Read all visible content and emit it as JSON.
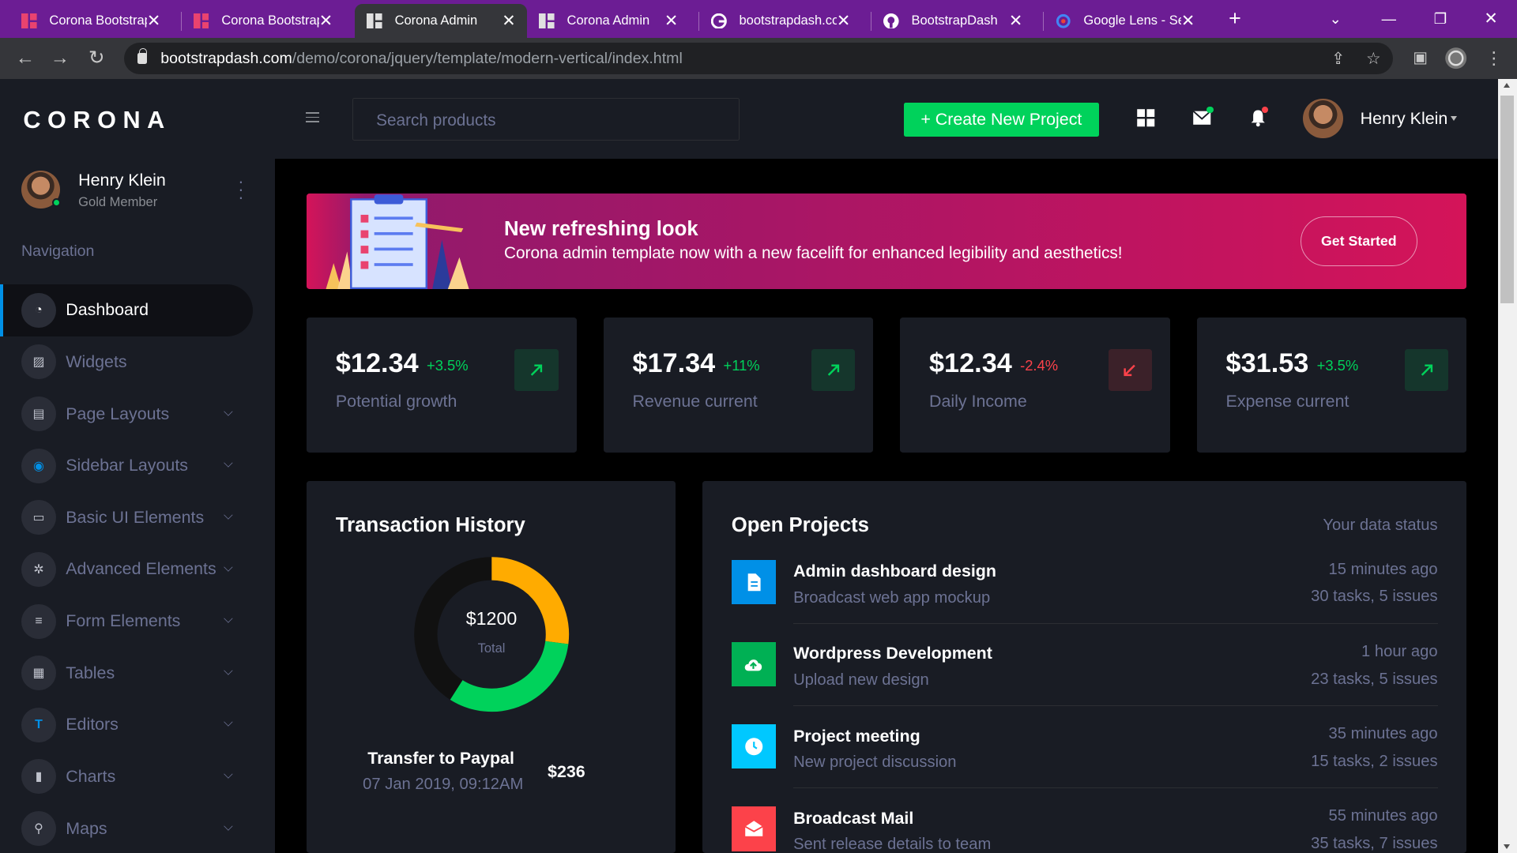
{
  "browser": {
    "tabs": [
      {
        "title": "Corona Bootstrap",
        "favicon": "corona-favicon"
      },
      {
        "title": "Corona Bootstrap",
        "favicon": "corona-favicon"
      },
      {
        "title": "Corona Admin",
        "favicon": "corona-favicon",
        "active": true
      },
      {
        "title": "Corona Admin",
        "favicon": "corona-favicon"
      },
      {
        "title": "bootstrapdash.com",
        "favicon": "google-favicon"
      },
      {
        "title": "BootstrapDash",
        "favicon": "github-favicon"
      },
      {
        "title": "Google Lens - Sea",
        "favicon": "google-lens-favicon"
      }
    ],
    "url_host": "bootstrapdash.com",
    "url_path": "/demo/corona/jquery/template/modern-vertical/index.html",
    "tabbar_color": "#6c1d94"
  },
  "sidebar": {
    "logo": "CORONA",
    "user_name": "Henry Klein",
    "user_rank": "Gold Member",
    "nav_heading": "Navigation",
    "items": [
      {
        "label": "Dashboard",
        "icon": "speedometer-icon",
        "active": true,
        "icon_color": "#ffffff"
      },
      {
        "label": "Widgets",
        "icon": "widgets-icon",
        "icon_color": "#bfc2cc"
      },
      {
        "label": "Page Layouts",
        "icon": "layouts-icon",
        "icon_color": "#bfc2cc",
        "submenu": true
      },
      {
        "label": "Sidebar Layouts",
        "icon": "sidebar-icon",
        "icon_color": "#0090e7",
        "submenu": true
      },
      {
        "label": "Basic UI Elements",
        "icon": "laptop-icon",
        "icon_color": "#bfc2cc",
        "submenu": true
      },
      {
        "label": "Advanced Elements",
        "icon": "gear-icon",
        "icon_color": "#bfc2cc",
        "submenu": true
      },
      {
        "label": "Form Elements",
        "icon": "form-icon",
        "icon_color": "#bfc2cc",
        "submenu": true
      },
      {
        "label": "Tables",
        "icon": "table-icon",
        "icon_color": "#bfc2cc",
        "submenu": true
      },
      {
        "label": "Editors",
        "icon": "editor-icon",
        "icon_color": "#0090e7",
        "submenu": true
      },
      {
        "label": "Charts",
        "icon": "chart-icon",
        "icon_color": "#bfc2cc",
        "submenu": true
      },
      {
        "label": "Maps",
        "icon": "map-pin-icon",
        "icon_color": "#bfc2cc",
        "submenu": true
      }
    ]
  },
  "topbar": {
    "search_placeholder": "Search products",
    "create_label": "+ Create New Project",
    "user_name": "Henry Klein",
    "accent_green": "#00d25b"
  },
  "banner": {
    "title": "New refreshing look",
    "subtitle": "Corona admin template now with a new facelift for enhanced legibility and aesthetics!",
    "button": "Get Started"
  },
  "stats": [
    {
      "value": "$12.34",
      "change": "+3.5%",
      "label": "Potential growth",
      "trend": "up"
    },
    {
      "value": "$17.34",
      "change": "+11%",
      "label": "Revenue current",
      "trend": "up"
    },
    {
      "value": "$12.34",
      "change": "-2.4%",
      "label": "Daily Income",
      "trend": "down"
    },
    {
      "value": "$31.53",
      "change": "+3.5%",
      "label": "Expense current",
      "trend": "up"
    }
  ],
  "transactions": {
    "title": "Transaction History",
    "total_value": "$1200",
    "total_label": "Total",
    "donut_shares": [
      0.27,
      0.32,
      0.41
    ],
    "donut_colors": [
      "#ffab00",
      "#00d25b",
      "#111111"
    ],
    "item_title": "Transfer to Paypal",
    "item_date": "07 Jan 2019, 09:12AM",
    "item_amount": "$236"
  },
  "projects": {
    "title": "Open Projects",
    "status_label": "Your data status",
    "items": [
      {
        "title": "Admin dashboard design",
        "subtitle": "Broadcast web app mockup",
        "time": "15 minutes ago",
        "tasks": "30 tasks, 5 issues",
        "icon": "document-icon",
        "color": "#0090e7"
      },
      {
        "title": "Wordpress Development",
        "subtitle": "Upload new design",
        "time": "1 hour ago",
        "tasks": "23 tasks, 5 issues",
        "icon": "cloud-upload-icon",
        "color": "#00b054"
      },
      {
        "title": "Project meeting",
        "subtitle": "New project discussion",
        "time": "35 minutes ago",
        "tasks": "15 tasks, 2 issues",
        "icon": "clock-icon",
        "color": "#00c8ff"
      },
      {
        "title": "Broadcast Mail",
        "subtitle": "Sent release details to team",
        "time": "55 minutes ago",
        "tasks": "35 tasks, 7 issues",
        "icon": "mail-open-icon",
        "color": "#fc424a"
      }
    ]
  }
}
